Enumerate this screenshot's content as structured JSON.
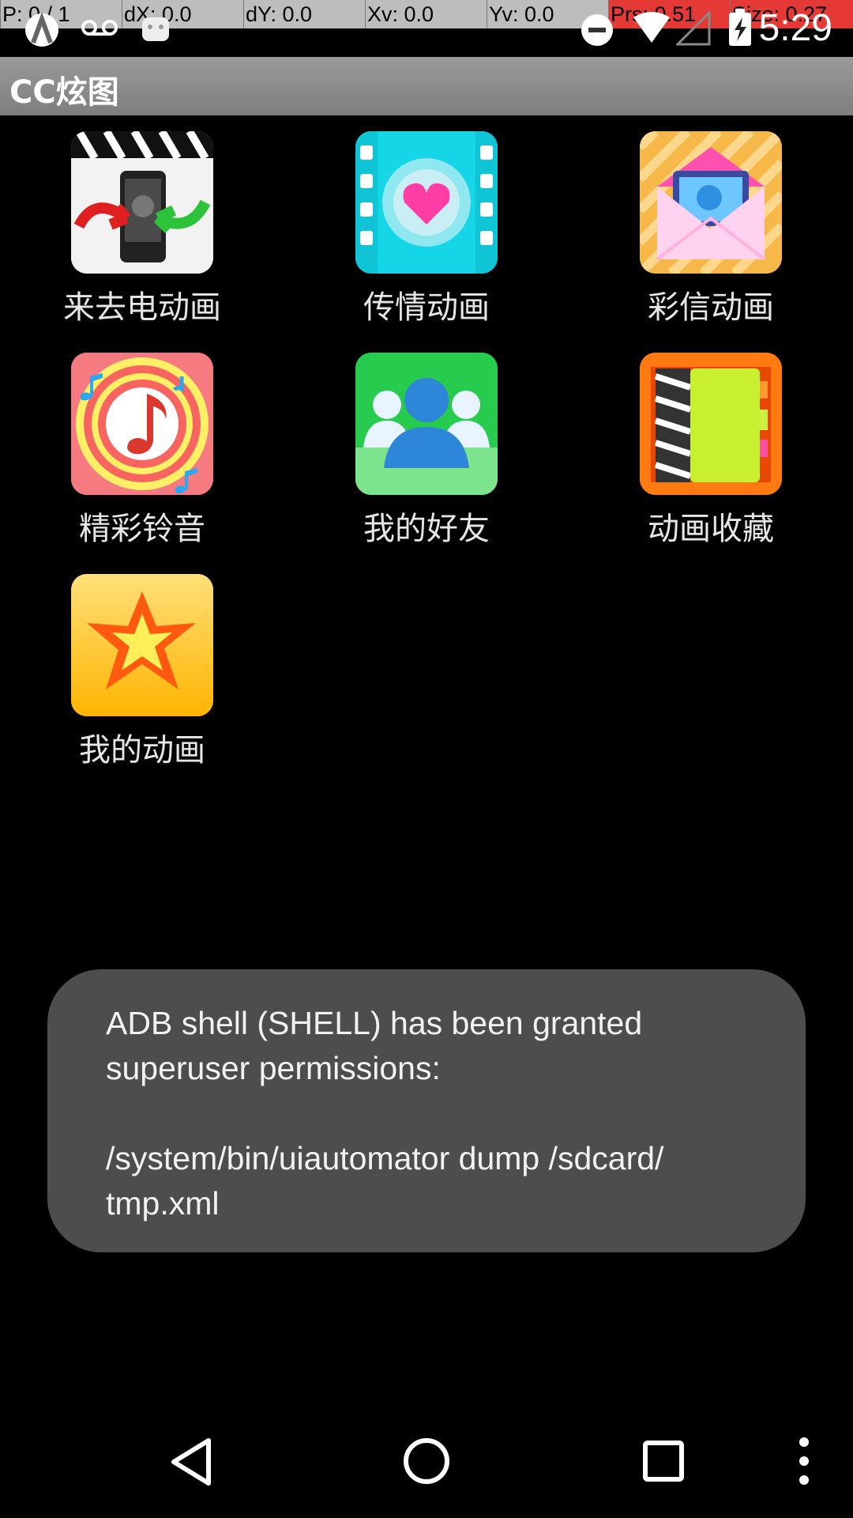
{
  "debug_bar": {
    "cells": [
      "P: 0 / 1",
      "dX: 0.0",
      "dY: 0.0",
      "Xv: 0.0",
      "Yv: 0.0",
      "Prs: 0.51",
      "Size: 0.27"
    ]
  },
  "status_bar": {
    "time": "5:29",
    "icons": [
      "android-debug-icon",
      "voicemail-icon",
      "notification-icon",
      "do-not-disturb-icon",
      "wifi-icon",
      "cell-signal-icon",
      "battery-charging-icon"
    ]
  },
  "app": {
    "title": "CC炫图"
  },
  "grid": {
    "items": [
      {
        "label": "来去电动画",
        "icon": "incoming-call-animation-icon"
      },
      {
        "label": "传情动画",
        "icon": "heart-film-icon"
      },
      {
        "label": "彩信动画",
        "icon": "mms-envelope-icon"
      },
      {
        "label": "精彩铃音",
        "icon": "ringtone-music-icon"
      },
      {
        "label": "我的好友",
        "icon": "friends-icon"
      },
      {
        "label": "动画收藏",
        "icon": "animation-collection-icon"
      },
      {
        "label": "我的动画",
        "icon": "my-animation-star-icon"
      }
    ]
  },
  "toast": {
    "text": "ADB shell (SHELL) has been granted\nsuperuser permissions:\n\n/system/bin/uiautomator dump /sdcard/\ntmp.xml"
  },
  "nav_bar": {
    "buttons": [
      "back-icon",
      "home-icon",
      "recents-icon",
      "overflow-menu-icon"
    ]
  },
  "colors": {
    "action_bar": "#8c8c8c",
    "toast_bg": "#4d4d4d",
    "debug_highlight": "#e53935"
  }
}
